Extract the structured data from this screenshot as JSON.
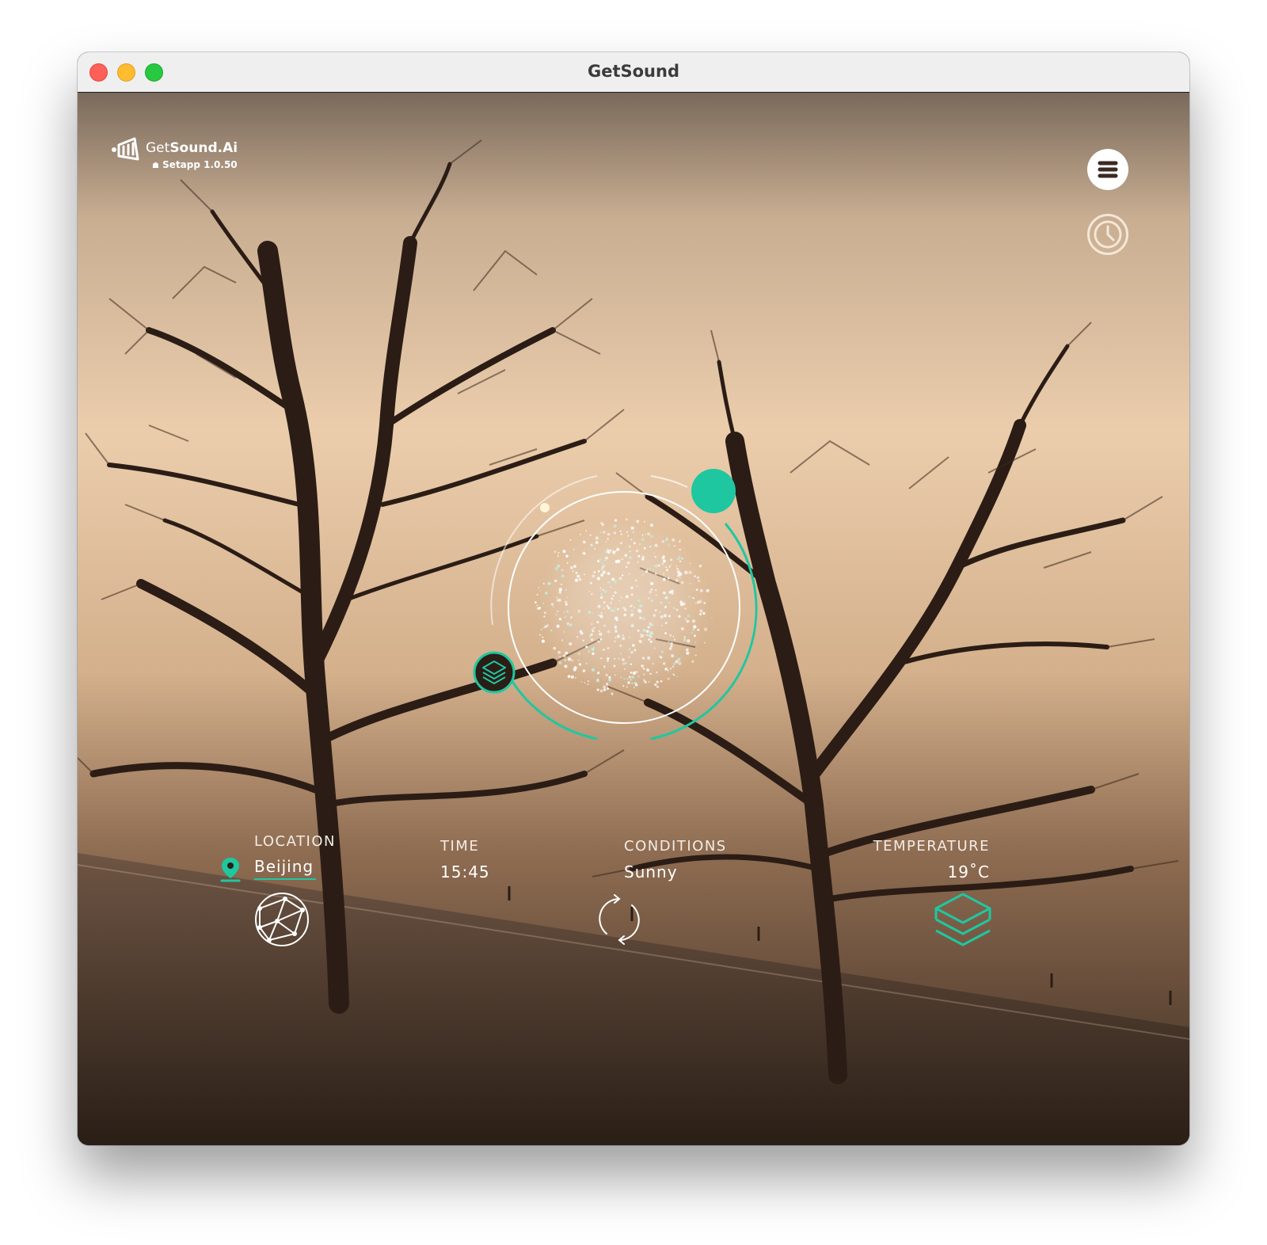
{
  "window": {
    "title": "GetSound"
  },
  "brand": {
    "name_light": "Get",
    "name_bold": "Sound.Ai",
    "subtitle": "Setapp 1.0.50"
  },
  "weather": {
    "location_label": "LOCATION",
    "location_value": "Beijing",
    "time_label": "TIME",
    "time_value": "15:45",
    "conditions_label": "CONDITIONS",
    "conditions_value": "Sunny",
    "temperature_label": "TEMPERATURE",
    "temperature_value": "19˚C"
  },
  "player": {
    "progress": 0.42
  },
  "colors": {
    "accent": "#1fc7a0",
    "text": "#ffffff",
    "titlebar": "#efefef"
  },
  "icons": {
    "menu": "hamburger-icon",
    "history": "clock-icon",
    "location": "location-pin-icon",
    "globe": "network-globe-icon",
    "refresh": "refresh-icon",
    "layers": "layers-icon"
  }
}
